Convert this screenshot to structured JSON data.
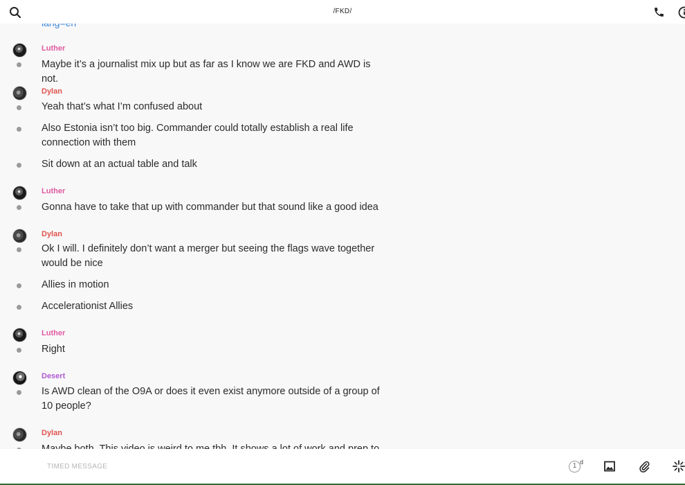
{
  "header": {
    "title": "/FKD/"
  },
  "thread": {
    "clipped_top_text": "lang=en",
    "groups": [
      {
        "sender": "Luther",
        "messages": [
          "Maybe it’s a journalist mix up but as far as I know we are FKD and AWD is not."
        ]
      },
      {
        "sender": "Dylan",
        "messages": [
          "Yeah that’s what I’m confused about",
          "Also Estonia isn’t too big. Commander could totally establish a real life connection with them",
          "Sit down at an actual table and talk"
        ]
      },
      {
        "sender": "Luther",
        "messages": [
          "Gonna have to take that up with commander but that sound like a good idea"
        ]
      },
      {
        "sender": "Dylan",
        "messages": [
          "Ok I will. I definitely don’t want a merger but seeing the flags wave together would be nice",
          "Allies in motion",
          "Accelerationist Allies"
        ]
      },
      {
        "sender": "Luther",
        "messages": [
          "Right"
        ]
      },
      {
        "sender": "Desert",
        "messages": [
          "Is AWD clean of the O9A or does it even exist anymore outside of a group of 10 people?"
        ]
      },
      {
        "sender": "Dylan",
        "messages": [
          "Maybe both. This video is weird to me tbh. It shows a lot of work and prep to"
        ]
      }
    ]
  },
  "composer": {
    "placeholder": "TIMED MESSAGE",
    "timer_value": "1",
    "timer_unit": "d"
  },
  "icons": {
    "search": "search-icon",
    "call": "phone-icon",
    "info": "info-icon",
    "image": "image-icon",
    "attach": "paperclip-icon",
    "spark": "sparkle-icon"
  }
}
